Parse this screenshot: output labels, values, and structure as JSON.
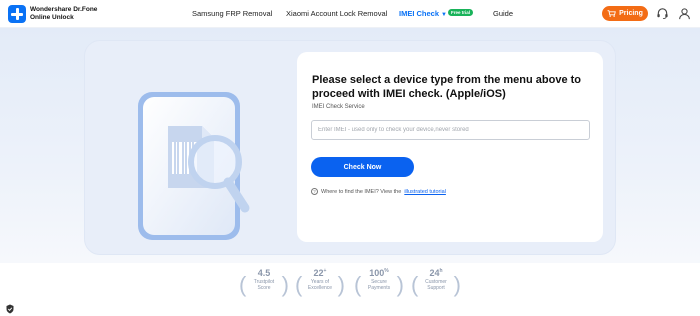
{
  "header": {
    "brand_line1": "Wondershare Dr.Fone",
    "brand_line2": "Online Unlock",
    "nav": [
      {
        "label": "Samsung FRP Removal"
      },
      {
        "label": "Xiaomi Account Lock Removal"
      },
      {
        "label": "IMEI Check",
        "active": true
      },
      {
        "label": "Guide"
      }
    ],
    "free_badge": "Free trial",
    "pricing_label": "Pricing",
    "icons": [
      "logo-plus-icon",
      "chevron-down-icon",
      "cart-icon",
      "headset-icon",
      "user-icon"
    ]
  },
  "form": {
    "title": "Please select a device type from the menu above to proceed with IMEI check. (Apple/iOS)",
    "service_label": "IMEI Check Service",
    "input_placeholder": "Enter IMEI - used only to check your device,never stored",
    "input_value": "",
    "button_label": "Check Now",
    "hint_text": "Where to find the IMEI? View the",
    "hint_link": "illustrated tutorial"
  },
  "stats": [
    {
      "value": "4.5",
      "suffix": "",
      "line1": "Trustpilot",
      "line2": "Score"
    },
    {
      "value": "22",
      "suffix": "+",
      "line1": "Years of",
      "line2": "Excellence"
    },
    {
      "value": "100",
      "suffix": "%",
      "line1": "Secure",
      "line2": "Payments"
    },
    {
      "value": "24",
      "suffix": "h",
      "line1": "Customer",
      "line2": "Support"
    }
  ],
  "colors": {
    "accent": "#0a62f0",
    "pricing": "#f36c15",
    "badge": "#19b35a",
    "hero_bg": "#e8eef9"
  }
}
